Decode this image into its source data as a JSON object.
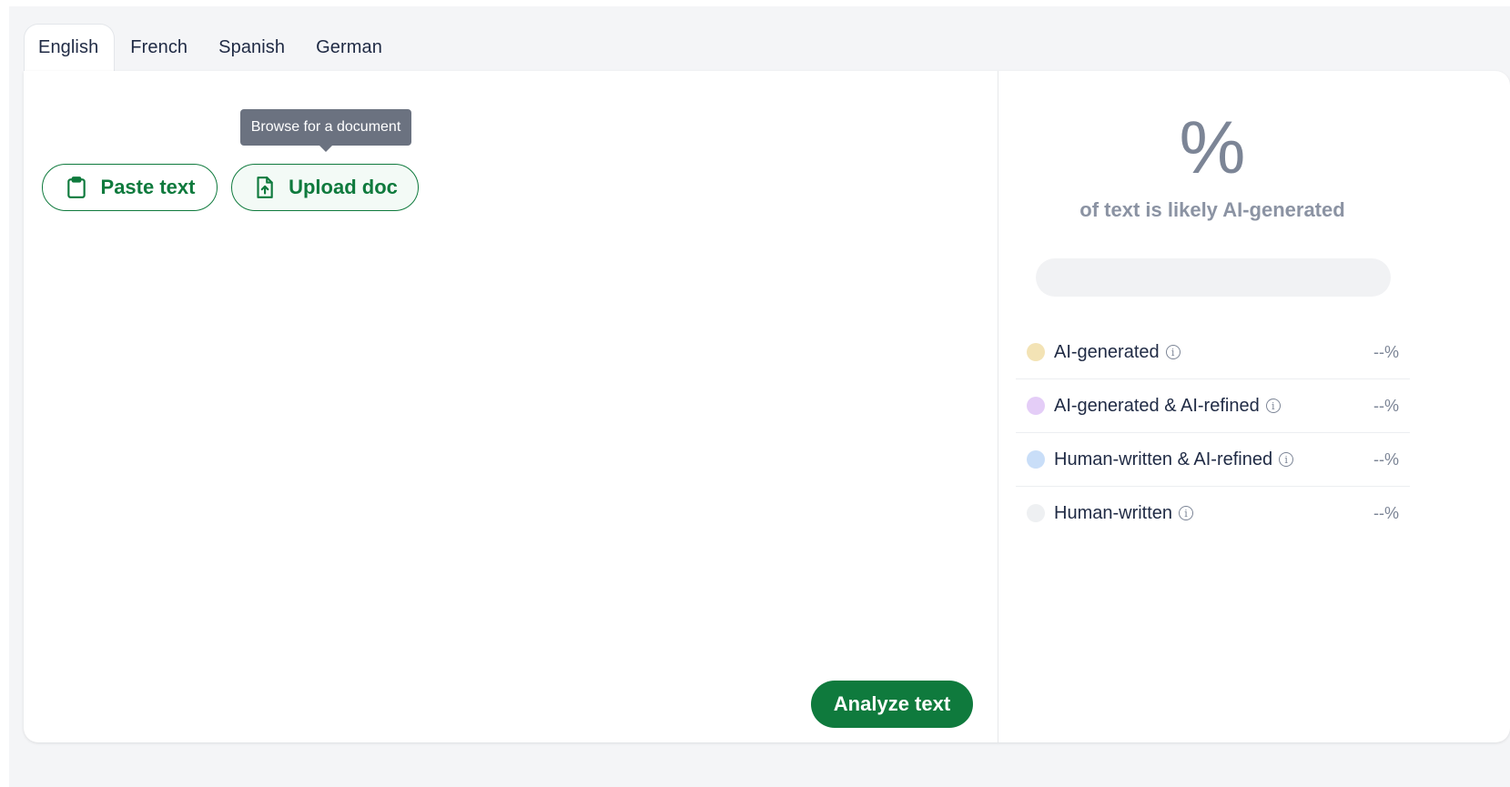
{
  "tabs": [
    {
      "label": "English",
      "active": true
    },
    {
      "label": "French"
    },
    {
      "label": "Spanish"
    },
    {
      "label": "German"
    }
  ],
  "actions": {
    "paste_label": "Paste text",
    "upload_label": "Upload doc",
    "upload_tooltip": "Browse for a document",
    "analyze_label": "Analyze text"
  },
  "results": {
    "percent_symbol": "%",
    "subtitle": "of text is likely AI-generated",
    "legend": [
      {
        "label": "AI-generated",
        "value": "--%",
        "color": "#f3e3b5"
      },
      {
        "label": "AI-generated & AI-refined",
        "value": "--%",
        "color": "#e4cdf7"
      },
      {
        "label": "Human-written & AI-refined",
        "value": "--%",
        "color": "#c9def8"
      },
      {
        "label": "Human-written",
        "value": "--%",
        "color": "#eef0f2"
      }
    ]
  },
  "colors": {
    "accent": "#0f7a3d"
  }
}
